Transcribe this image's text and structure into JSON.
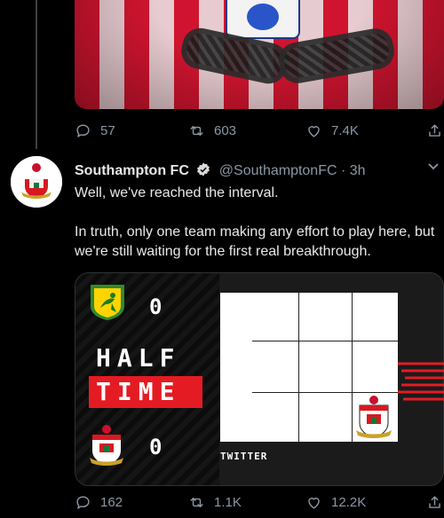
{
  "prev_tweet": {
    "actions": {
      "replies": "57",
      "retweets": "603",
      "likes": "7.4K"
    }
  },
  "tweet": {
    "author_name": "Southampton FC",
    "handle": "@SouthamptonFC",
    "separator": "·",
    "time": "3h",
    "paragraph1": "Well, we've reached the interval.",
    "paragraph2": "In truth, only one team making any effort to play here, but we're still waiting for the first real breakthrough.",
    "card": {
      "home_score": "0",
      "away_score": "0",
      "status_line1": "HALF",
      "status_line2": "TIME",
      "board_sponsor": "TWITTER"
    },
    "actions": {
      "replies": "162",
      "retweets": "1.1K",
      "likes": "12.2K"
    }
  },
  "colors": {
    "background": "#000000",
    "muted": "#8b98a5",
    "text": "#e7e9ea",
    "accent_red": "#e41b23",
    "verified_blue": "#1d9bf0"
  }
}
